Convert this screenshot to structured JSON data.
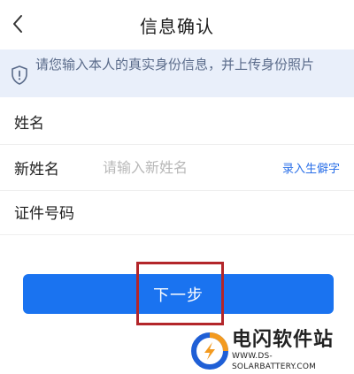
{
  "header": {
    "title": "信息确认",
    "back_icon": "chevron-left-icon"
  },
  "notice": {
    "icon": "shield-exclamation-icon",
    "text": "请您输入本人的真实身份信息，并上传身份照片"
  },
  "form": {
    "name": {
      "label": "姓名",
      "value": ""
    },
    "new_name": {
      "label": "新姓名",
      "placeholder": "请输入新姓名",
      "rare_char_link": "录入生僻字"
    },
    "id_number": {
      "label": "证件号码",
      "value": ""
    }
  },
  "actions": {
    "next_label": "下一步"
  },
  "watermark": {
    "name": "电闪软件站",
    "url": "WWW.DS-SOLARBATTERY.COM"
  },
  "colors": {
    "primary": "#1a73f0",
    "notice_bg": "#e9effa",
    "notice_text": "#5a6b8a",
    "link": "#2a6fe8",
    "highlight_box": "#b3262a"
  }
}
